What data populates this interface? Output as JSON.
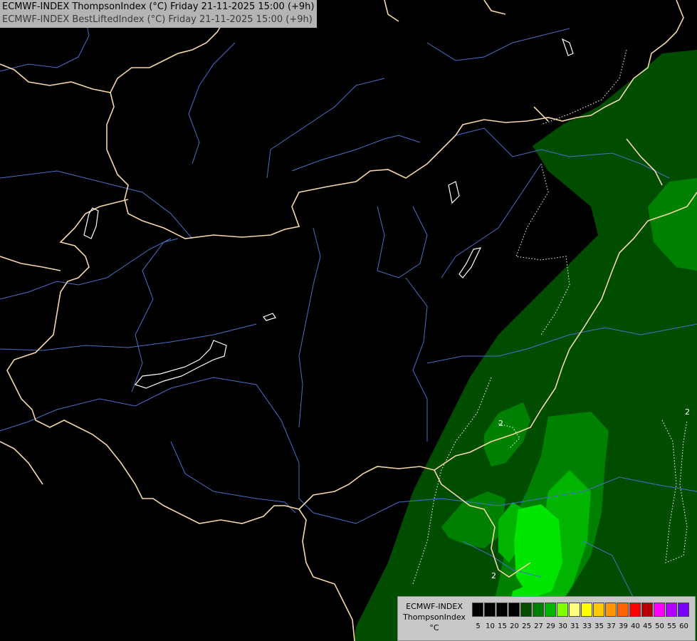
{
  "header": {
    "line1": "ECMWF-INDEX ThompsonIndex (°C) Friday 21-11-2025 15:00 (+9h)",
    "line2": "ECMWF-INDEX BestLiftedIndex (°C) Friday 21-11-2025 15:00 (+9h)"
  },
  "legend": {
    "model": "ECMWF-INDEX",
    "parameter": "ThompsonIndex",
    "unit": "°C",
    "classes": [
      {
        "label": "5",
        "color": "#000000"
      },
      {
        "label": "10",
        "color": "#000000"
      },
      {
        "label": "15",
        "color": "#000000"
      },
      {
        "label": "20",
        "color": "#000000"
      },
      {
        "label": "25",
        "color": "#004d00"
      },
      {
        "label": "27",
        "color": "#008000"
      },
      {
        "label": "29",
        "color": "#00b400"
      },
      {
        "label": "30",
        "color": "#80ff00"
      },
      {
        "label": "31",
        "color": "#ffff80"
      },
      {
        "label": "33",
        "color": "#ffff00"
      },
      {
        "label": "35",
        "color": "#ffc800"
      },
      {
        "label": "37",
        "color": "#ff9600"
      },
      {
        "label": "39",
        "color": "#ff6400"
      },
      {
        "label": "40",
        "color": "#ff0000"
      },
      {
        "label": "45",
        "color": "#b40000"
      },
      {
        "label": "50",
        "color": "#ff00ff"
      },
      {
        "label": "55",
        "color": "#b400ff"
      },
      {
        "label": "60",
        "color": "#7800ff"
      }
    ]
  },
  "contour_labels": [
    "2",
    "2",
    "2"
  ],
  "colors": {
    "border": "#f5d8a8",
    "river": "#4a6fc9",
    "field_dark": "#004d00",
    "field_mid": "#008000",
    "field_bright": "#00b400",
    "field_lime": "#00e600",
    "lake_outline": "#ffffff"
  }
}
